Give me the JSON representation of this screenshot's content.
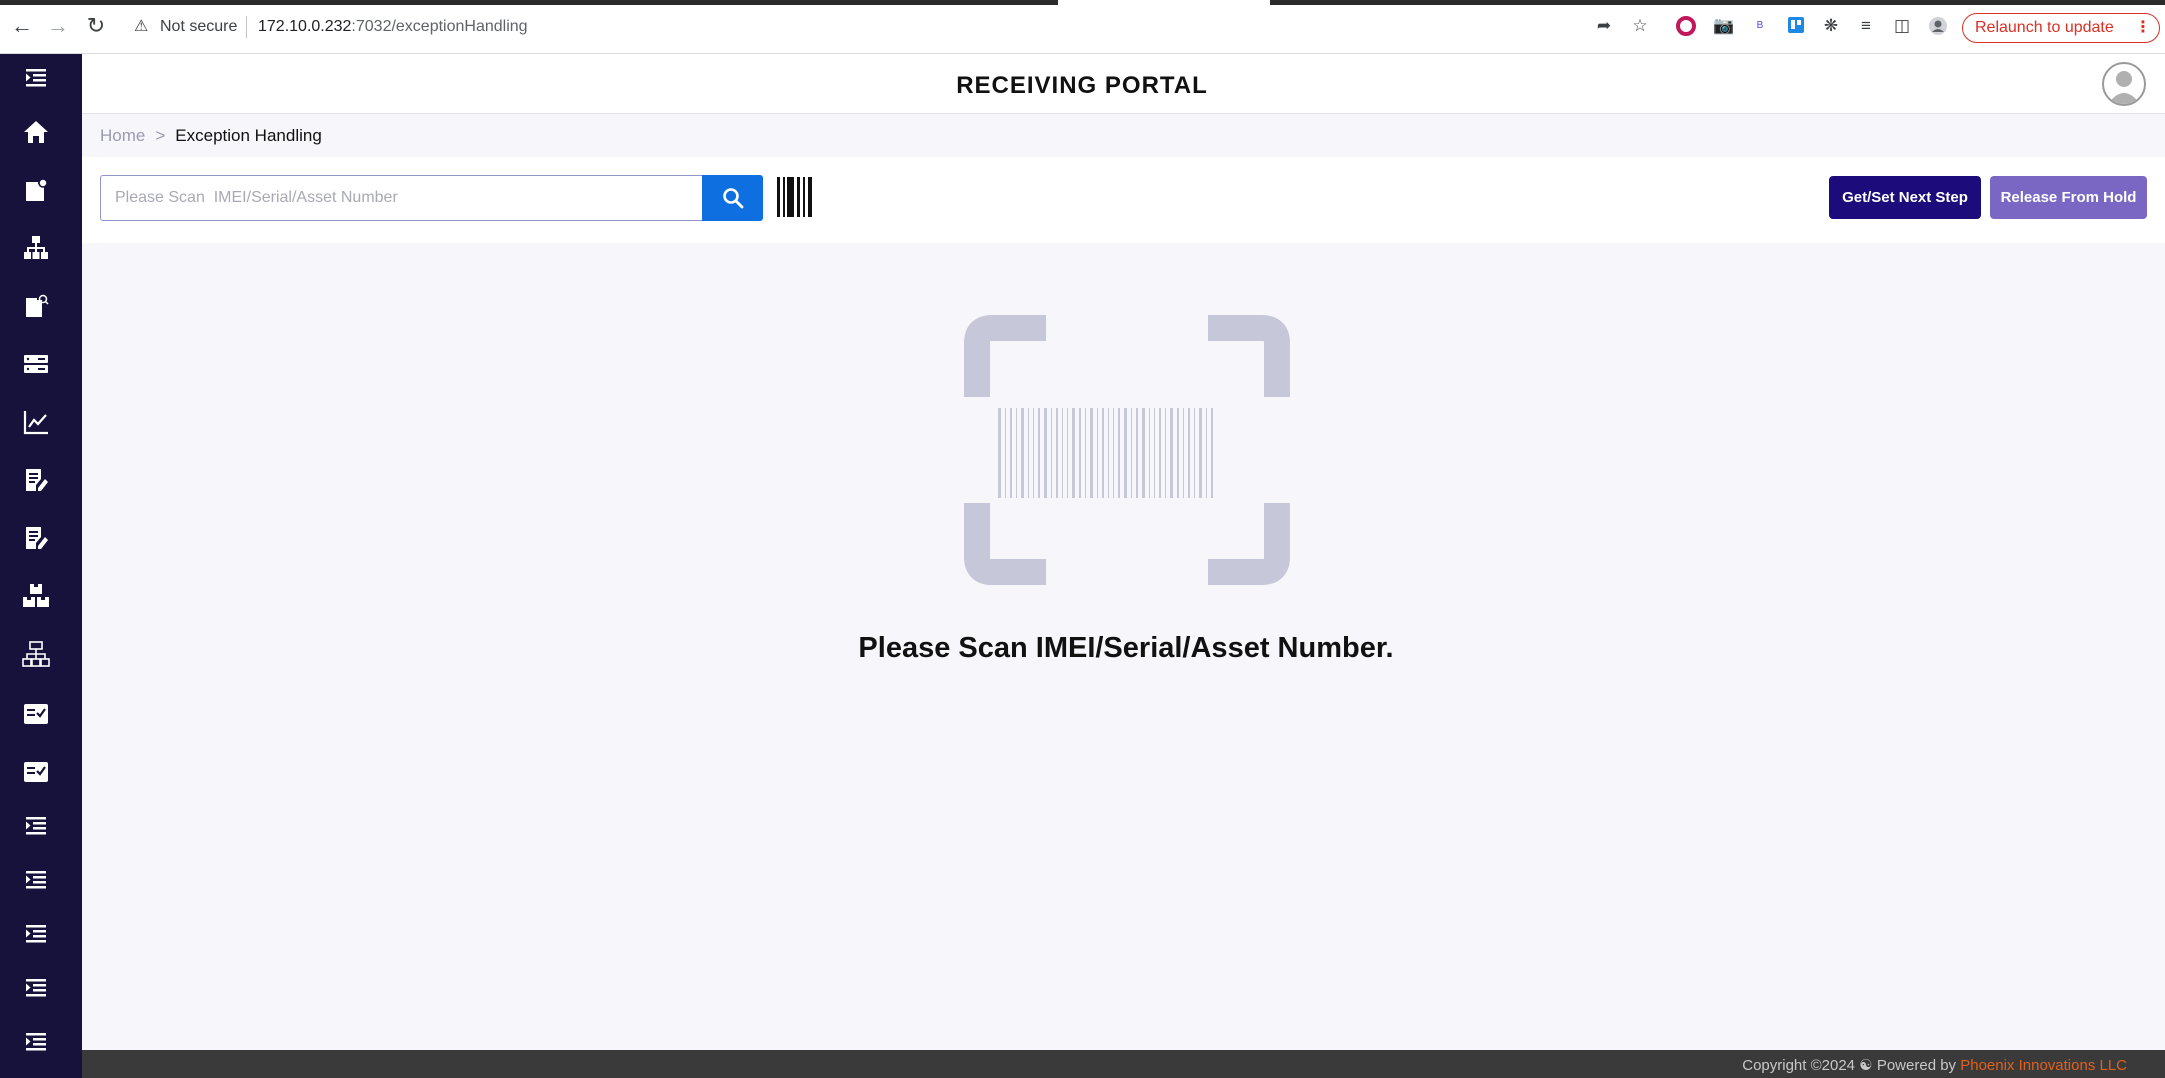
{
  "browser": {
    "security_label": "Not secure",
    "url_host": "172.10.0.232",
    "url_path": ":7032/exceptionHandling",
    "relaunch_label": "Relaunch to update"
  },
  "app": {
    "title": "RECEIVING PORTAL"
  },
  "breadcrumb": {
    "home": "Home",
    "separator": ">",
    "current": "Exception Handling"
  },
  "toolbar": {
    "search_placeholder": "Please Scan  IMEI/Serial/Asset Number",
    "next_step_label": "Get/Set Next Step",
    "release_label": "Release From Hold"
  },
  "main": {
    "prompt": "Please Scan IMEI/Serial/Asset Number."
  },
  "footer": {
    "copyright": "Copyright ©2024",
    "powered_by": "Powered by",
    "company": "Phoenix Innovations LLC"
  },
  "sidebar": {
    "items": [
      "menu-indent-icon",
      "home-icon",
      "document-badge-icon",
      "hierarchy-icon",
      "document-search-icon",
      "server-icon",
      "chart-line-icon",
      "edit-document-icon",
      "edit-document-icon",
      "boxes-icon",
      "network-icon",
      "checklist-icon",
      "checklist-icon",
      "menu-indent-icon",
      "menu-indent-icon",
      "menu-indent-icon",
      "menu-indent-icon",
      "menu-indent-icon"
    ]
  },
  "colors": {
    "sidebar_bg": "#16123c",
    "primary_button": "#1c0b7a",
    "secondary_button": "#7a67c4",
    "search_button": "#0d6fe0",
    "brand_orange": "#e0601c"
  }
}
